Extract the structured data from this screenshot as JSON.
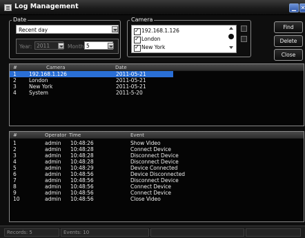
{
  "window": {
    "title": "Log Management"
  },
  "date_group": {
    "legend": "Date",
    "range_value": "Recent day",
    "year_label": "Year:",
    "year_value": "2011",
    "month_label": "Month:",
    "month_value": "5"
  },
  "camera_group": {
    "legend": "Camera",
    "items": [
      {
        "label": "192.168.1.126",
        "checked": true
      },
      {
        "label": "London",
        "checked": true
      },
      {
        "label": "New York",
        "checked": true
      }
    ]
  },
  "buttons": {
    "find": "Find",
    "delete": "Delete",
    "close": "Close"
  },
  "camera_log": {
    "columns": [
      "#",
      "Camera",
      "Date"
    ],
    "rows": [
      [
        "1",
        "192.168.1.126",
        "2011-05-21"
      ],
      [
        "2",
        "London",
        "2011-05-21"
      ],
      [
        "3",
        "New York",
        "2011-05-21"
      ],
      [
        "4",
        "System",
        "2011-5-20"
      ]
    ]
  },
  "event_log": {
    "columns": [
      "#",
      "Operator",
      "Time",
      "Event"
    ],
    "rows": [
      [
        "1",
        "admin",
        "10:48:26",
        "Show Video"
      ],
      [
        "2",
        "admin",
        "10:48:28",
        "Connect Device"
      ],
      [
        "3",
        "admin",
        "10:48:28",
        "Disconnect Device"
      ],
      [
        "4",
        "admin",
        "10:48:28",
        "Disconnect Device"
      ],
      [
        "5",
        "admin",
        "10:48:29",
        "Device Connected"
      ],
      [
        "6",
        "admin",
        "10:48:56",
        "Device Disconnected"
      ],
      [
        "7",
        "admin",
        "10:48:56",
        "Disconnect Device"
      ],
      [
        "8",
        "admin",
        "10:48:56",
        "Connect Device"
      ],
      [
        "9",
        "admin",
        "10:48:56",
        "Connect Device"
      ],
      [
        "10",
        "admin",
        "10:48:56",
        "Close Video"
      ]
    ]
  },
  "status_bar": {
    "records": "Records: 5",
    "events": "Events: 10"
  }
}
